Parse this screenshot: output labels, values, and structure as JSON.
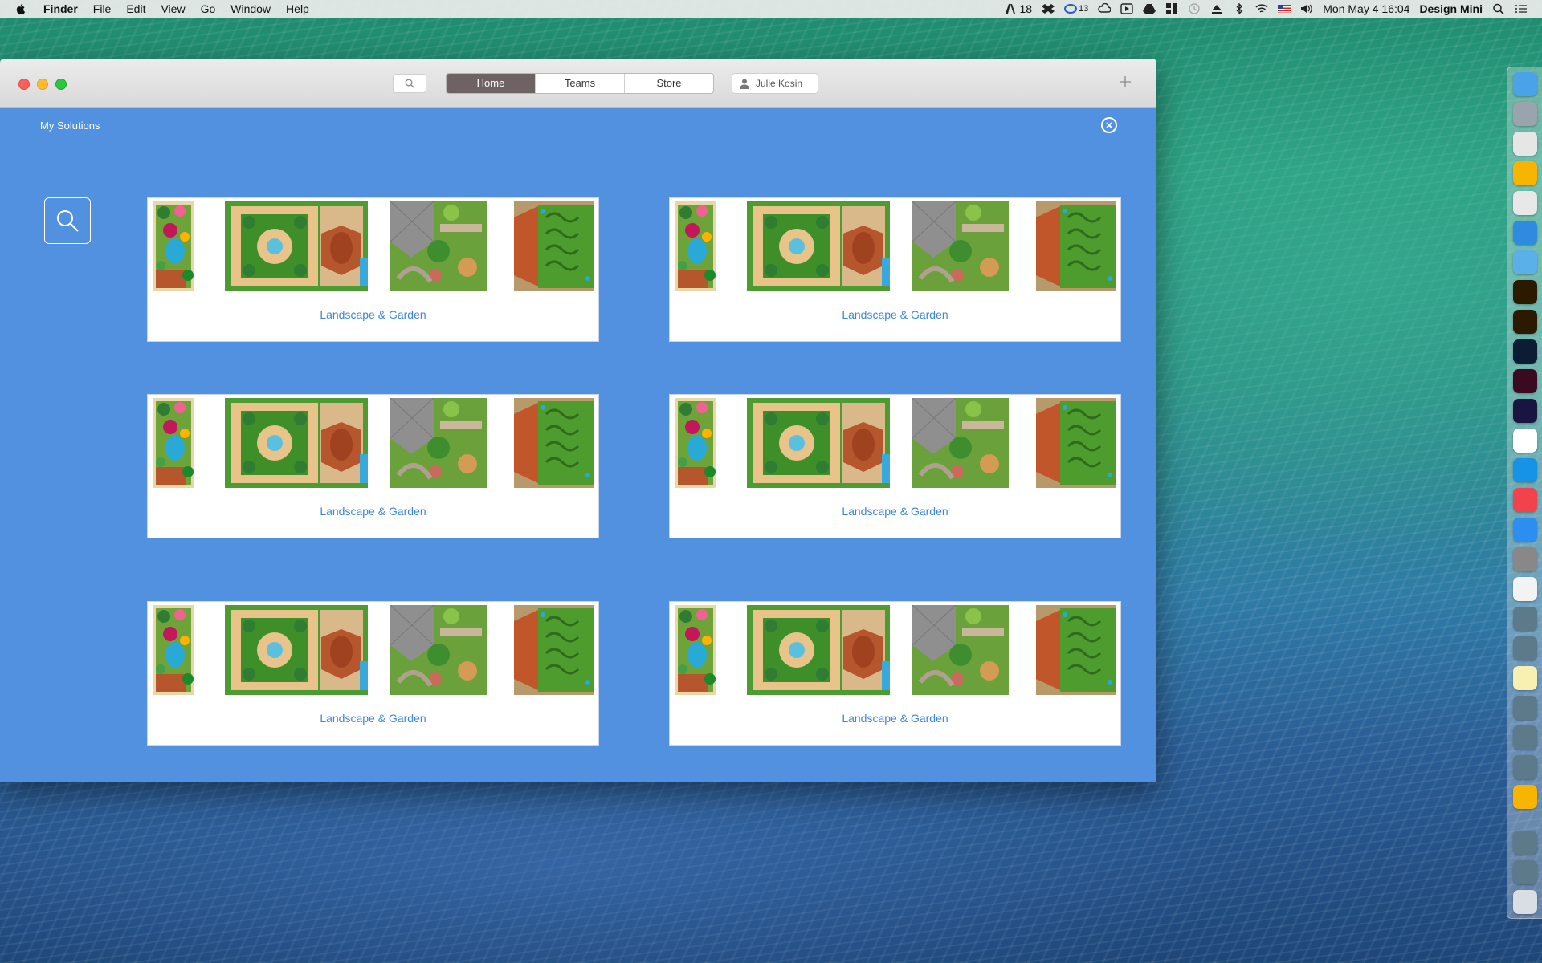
{
  "menubar": {
    "app_name": "Finder",
    "menus": [
      "File",
      "Edit",
      "View",
      "Go",
      "Window",
      "Help"
    ],
    "status": {
      "adobe_count": "18",
      "cc_count": "13",
      "datetime": "Mon May 4  16:04",
      "user": "Design Mini"
    }
  },
  "window": {
    "tabs": [
      {
        "label": "Home",
        "active": true
      },
      {
        "label": "Teams",
        "active": false
      },
      {
        "label": "Store",
        "active": false
      }
    ],
    "account_name": "Julie Kosin",
    "section_title": "My Solutions",
    "cards": [
      {
        "label": "Landscape & Garden"
      },
      {
        "label": "Landscape & Garden"
      },
      {
        "label": "Landscape & Garden"
      },
      {
        "label": "Landscape & Garden"
      },
      {
        "label": "Landscape & Garden"
      },
      {
        "label": "Landscape & Garden"
      }
    ]
  },
  "dock": {
    "items": [
      "finder",
      "launchpad",
      "skype",
      "sketch",
      "chrome",
      "safari",
      "mail",
      "illustrator",
      "illustrator",
      "photoshop",
      "indesign",
      "after-effects",
      "word",
      "shazam",
      "itunes",
      "app-store",
      "system-preferences",
      "photos",
      "app",
      "app",
      "notes",
      "app",
      "app",
      "app",
      "sketch",
      "app",
      "app",
      "trash"
    ]
  },
  "colors": {
    "window_bg": "#5191df",
    "card_label": "#3b86da",
    "active_tab": "#6e6362"
  }
}
